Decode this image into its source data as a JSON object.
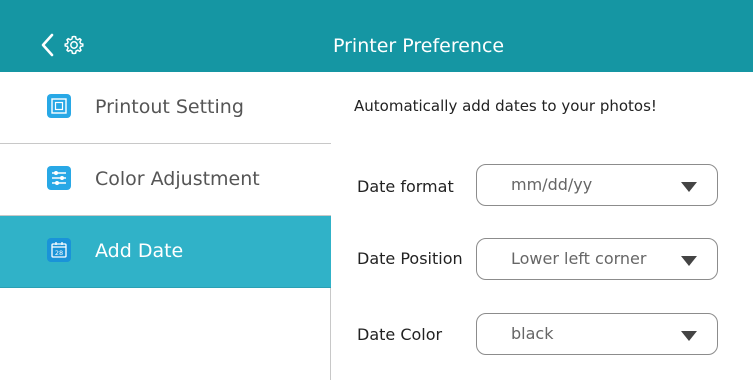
{
  "header": {
    "title": "Printer Preference",
    "back_icon": "chevron-left-icon",
    "settings_icon": "gear-icon",
    "background_color": "#1596a3"
  },
  "sidebar": {
    "items": [
      {
        "label": "Printout Setting",
        "icon": "printout-setting-icon",
        "active": false
      },
      {
        "label": "Color Adjustment",
        "icon": "sliders-icon",
        "active": false
      },
      {
        "label": "Add Date",
        "icon": "calendar-icon",
        "icon_text": "28",
        "active": true
      }
    ],
    "active_color": "#30b2c8"
  },
  "main": {
    "hint": "Automatically add dates to your photos!",
    "rows": [
      {
        "label": "Date format",
        "value": "mm/dd/yy"
      },
      {
        "label": "Date Position",
        "value": "Lower left corner"
      },
      {
        "label": "Date Color",
        "value": "black"
      }
    ]
  }
}
